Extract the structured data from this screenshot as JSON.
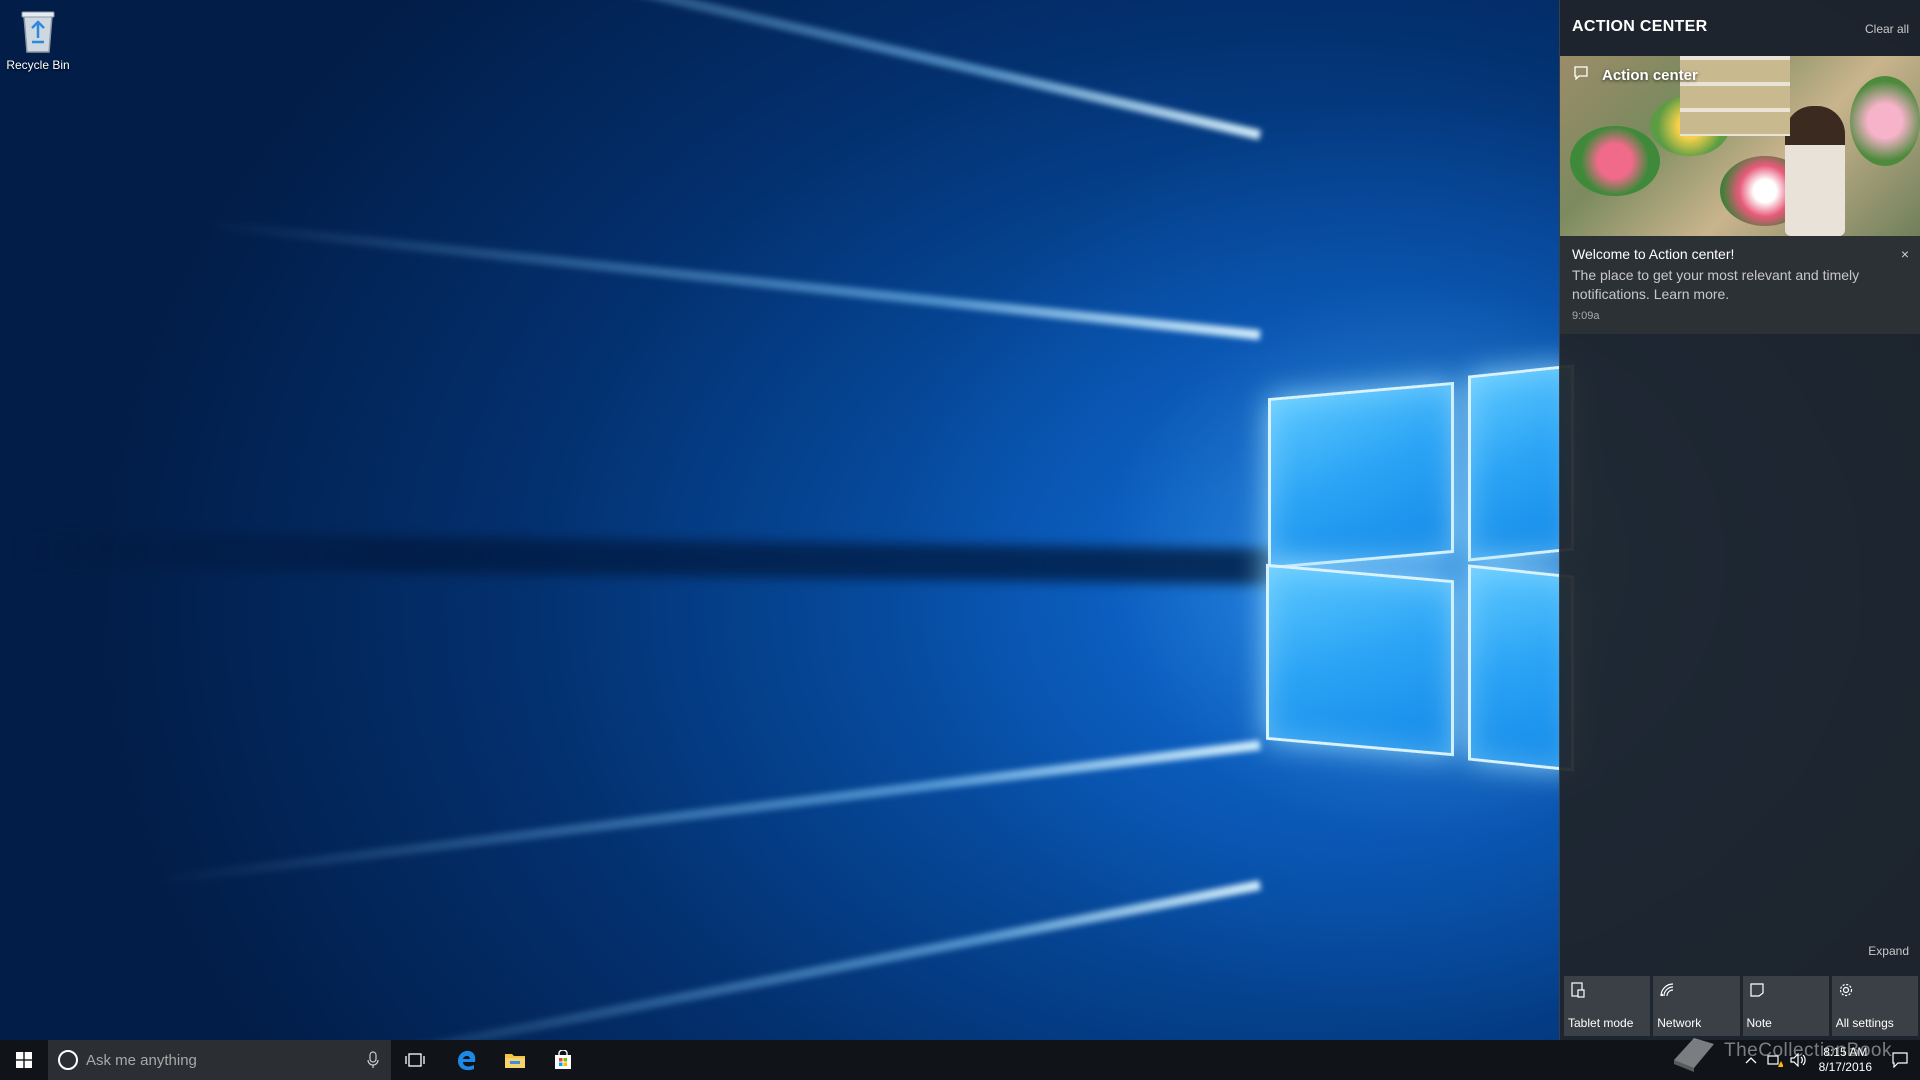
{
  "desktop": {
    "icons": [
      {
        "label": "Recycle Bin",
        "icon": "recycle-bin-icon"
      }
    ]
  },
  "taskbar": {
    "start_icon": "windows-logo-icon",
    "search_placeholder": "Ask me anything",
    "pinned": [
      {
        "name": "task-view",
        "icon": "task-view-icon"
      },
      {
        "name": "edge",
        "icon": "edge-icon"
      },
      {
        "name": "file-explorer",
        "icon": "folder-icon"
      },
      {
        "name": "store",
        "icon": "store-icon"
      }
    ],
    "clock_time": "8:15 AM",
    "clock_date": "8/17/2016"
  },
  "watermark": "TheCollectionBook",
  "action_center": {
    "title": "ACTION CENTER",
    "clear_all": "Clear all",
    "notification": {
      "app_name": "Action center",
      "title": "Welcome to Action center!",
      "body": "The place to get your most relevant and timely notifications. Learn more.",
      "time": "9:09a",
      "close": "×"
    },
    "expand": "Expand",
    "quick_actions": [
      {
        "label": "Tablet mode",
        "icon": "tablet-mode-icon"
      },
      {
        "label": "Network",
        "icon": "network-icon"
      },
      {
        "label": "Note",
        "icon": "note-icon"
      },
      {
        "label": "All settings",
        "icon": "gear-icon"
      }
    ]
  },
  "colors": {
    "taskbar_bg": "#101418",
    "action_center_bg": "#1f2429",
    "accent": "#0078d7"
  }
}
